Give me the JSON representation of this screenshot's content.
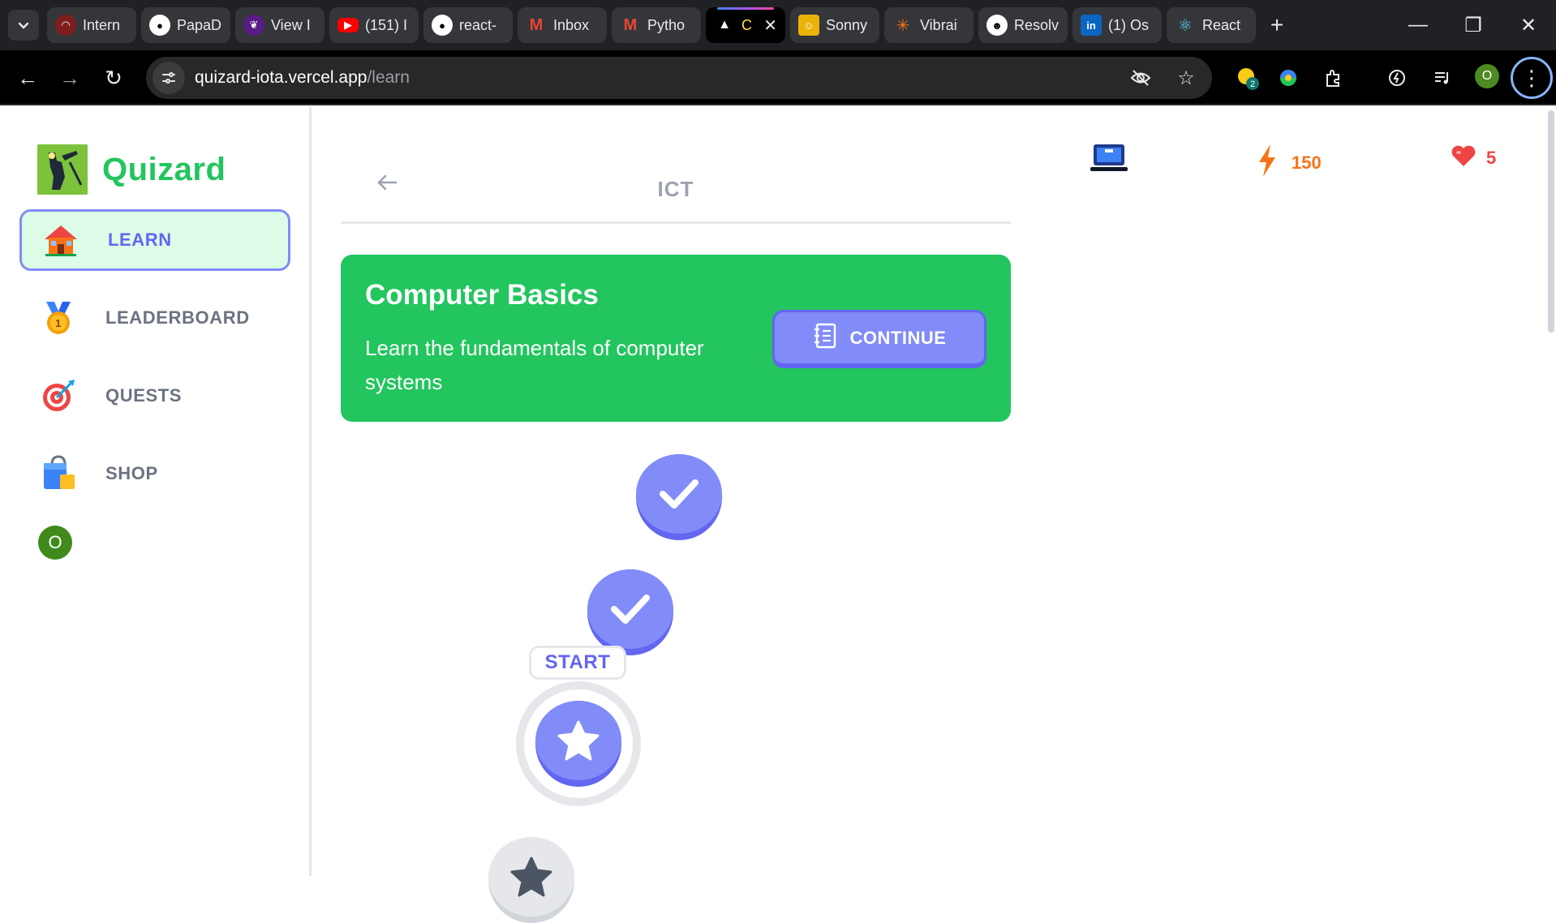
{
  "browser": {
    "tabs": [
      {
        "label": "Intern",
        "icon": "red-logo-icon",
        "color": "#b91c1c"
      },
      {
        "label": "PapaD",
        "icon": "github-icon",
        "color": "#ffffff"
      },
      {
        "label": "View I",
        "icon": "leaf-icon",
        "color": "#6b21a8"
      },
      {
        "label": "(151) I",
        "icon": "youtube-icon",
        "color": "#ff0000"
      },
      {
        "label": "react-",
        "icon": "github-icon",
        "color": "#ffffff"
      },
      {
        "label": "Inbox",
        "icon": "gmail-icon",
        "color": "#ea4335"
      },
      {
        "label": "Pytho",
        "icon": "gmail-icon",
        "color": "#ea4335"
      },
      {
        "label": "C",
        "icon": "vercel-icon",
        "color": "#ffffff",
        "active": true
      },
      {
        "label": "Sonny",
        "icon": "avatar-icon",
        "color": "#eab308"
      },
      {
        "label": "Vibrai",
        "icon": "sparkle-icon",
        "color": "#f97316"
      },
      {
        "label": "Resolv",
        "icon": "chat-icon",
        "color": "#ffffff"
      },
      {
        "label": "(1) Os",
        "icon": "linkedin-icon",
        "color": "#0a66c2"
      },
      {
        "label": "React",
        "icon": "react-icon",
        "color": "#61dafb"
      }
    ],
    "url_host": "quizard-iota.vercel.app",
    "url_path": "/learn",
    "extension_badge": "2",
    "profile_initial": "O"
  },
  "app": {
    "name": "Quizard",
    "nav": [
      {
        "label": "LEARN",
        "icon": "house-icon",
        "active": true
      },
      {
        "label": "LEADERBOARD",
        "icon": "medal-icon",
        "active": false
      },
      {
        "label": "QUESTS",
        "icon": "target-icon",
        "active": false
      },
      {
        "label": "SHOP",
        "icon": "shopping-bag-icon",
        "active": false
      }
    ],
    "user_initial": "O"
  },
  "unit": {
    "title": "ICT",
    "banner_title": "Computer Basics",
    "banner_desc": "Learn the fundamentals of computer systems",
    "continue_label": "CONTINUE",
    "start_label": "START"
  },
  "stats": {
    "course_icon": "laptop-icon",
    "streak": "150",
    "hearts": "5"
  },
  "colors": {
    "brand_green": "#22c55e",
    "accent_indigo": "#818cf8",
    "streak_orange": "#f97316",
    "heart_red": "#ef4444"
  }
}
